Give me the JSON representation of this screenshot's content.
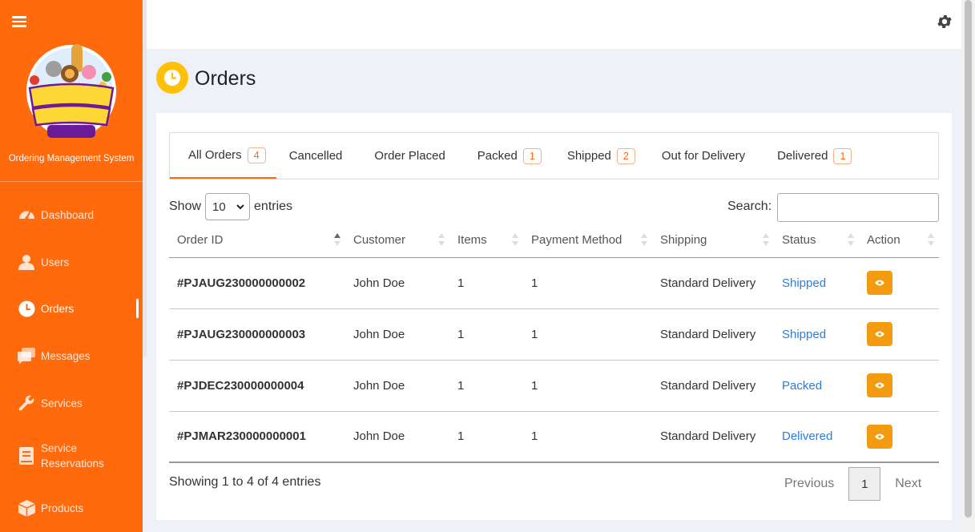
{
  "app": {
    "brand_subtitle": "Ordering Management System",
    "accent_color": "#ff6a0d",
    "logo_text": [
      "PARTY",
      "JUNGLE",
      "PARTY NEEDS & TOYS"
    ]
  },
  "sidebar": {
    "items": [
      {
        "label": "Dashboard",
        "icon": "gauge-icon"
      },
      {
        "label": "Users",
        "icon": "user-icon"
      },
      {
        "label": "Orders",
        "icon": "clock-icon",
        "active": true
      },
      {
        "label": "Messages",
        "icon": "messages-icon"
      },
      {
        "label": "Services",
        "icon": "wrench-icon"
      },
      {
        "label": "Service Reservations",
        "icon": "book-icon"
      },
      {
        "label": "Products",
        "icon": "box-icon"
      }
    ]
  },
  "header": {
    "title": "Orders",
    "icon": "clock-icon"
  },
  "tabs": [
    {
      "label": "All Orders",
      "count": "4",
      "active": true
    },
    {
      "label": "Cancelled",
      "count": ""
    },
    {
      "label": "Order Placed",
      "count": ""
    },
    {
      "label": "Packed",
      "count": "1"
    },
    {
      "label": "Shipped",
      "count": "2"
    },
    {
      "label": "Out for Delivery",
      "count": ""
    },
    {
      "label": "Delivered",
      "count": "1"
    }
  ],
  "length": {
    "show": "Show",
    "value": "10",
    "entries": "entries"
  },
  "search": {
    "label": "Search:",
    "value": ""
  },
  "table": {
    "columns": [
      "Order ID",
      "Customer",
      "Items",
      "Payment Method",
      "Shipping",
      "Status",
      "Action"
    ],
    "rows": [
      {
        "order_id": "#PJAUG230000000002",
        "customer": "John Doe",
        "items": "1",
        "payment": "1",
        "shipping": "Standard Delivery",
        "status": "Shipped"
      },
      {
        "order_id": "#PJAUG230000000003",
        "customer": "John Doe",
        "items": "1",
        "payment": "1",
        "shipping": "Standard Delivery",
        "status": "Shipped"
      },
      {
        "order_id": "#PJDEC230000000004",
        "customer": "John Doe",
        "items": "1",
        "payment": "1",
        "shipping": "Standard Delivery",
        "status": "Packed"
      },
      {
        "order_id": "#PJMAR230000000001",
        "customer": "John Doe",
        "items": "1",
        "payment": "1",
        "shipping": "Standard Delivery",
        "status": "Delivered"
      }
    ]
  },
  "footer": {
    "info": "Showing 1 to 4 of 4 entries",
    "previous": "Previous",
    "page": "1",
    "next": "Next"
  }
}
